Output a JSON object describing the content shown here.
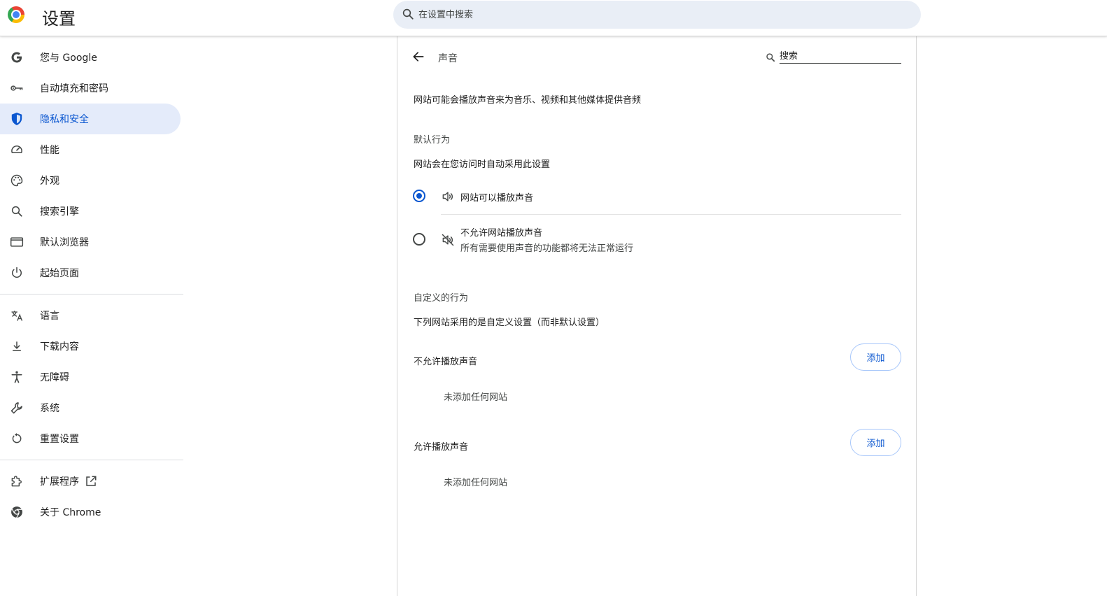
{
  "header": {
    "title": "设置",
    "search_placeholder": "在设置中搜索"
  },
  "sidebar": {
    "items": [
      {
        "label": "您与 Google",
        "icon": "google-g-icon"
      },
      {
        "label": "自动填充和密码",
        "icon": "key-icon"
      },
      {
        "label": "隐私和安全",
        "icon": "shield-icon",
        "active": true
      },
      {
        "label": "性能",
        "icon": "speedometer-icon"
      },
      {
        "label": "外观",
        "icon": "palette-icon"
      },
      {
        "label": "搜索引擎",
        "icon": "search-icon"
      },
      {
        "label": "默认浏览器",
        "icon": "browser-window-icon"
      },
      {
        "label": "起始页面",
        "icon": "power-icon"
      },
      {
        "label": "语言",
        "icon": "translate-icon"
      },
      {
        "label": "下载内容",
        "icon": "download-icon"
      },
      {
        "label": "无障碍",
        "icon": "accessibility-icon"
      },
      {
        "label": "系统",
        "icon": "wrench-icon"
      },
      {
        "label": "重置设置",
        "icon": "reset-icon"
      },
      {
        "label": "扩展程序",
        "icon": "puzzle-icon"
      },
      {
        "label": "关于 Chrome",
        "icon": "chrome-icon"
      }
    ]
  },
  "main": {
    "page_title": "声音",
    "search_placeholder": "搜索",
    "description": "网站可能会播放声音来为音乐、视频和其他媒体提供音频",
    "default_behavior": {
      "heading": "默认行为",
      "subheading": "网站会在您访问时自动采用此设置",
      "options": [
        {
          "label": "网站可以播放声音",
          "icon": "volume-up-icon",
          "checked": true
        },
        {
          "label": "不允许网站播放声音",
          "sublabel": "所有需要使用声音的功能都将无法正常运行",
          "icon": "volume-off-icon",
          "checked": false
        }
      ]
    },
    "custom_behavior": {
      "heading": "自定义的行为",
      "subheading": "下列网站采用的是自定义设置（而非默认设置）",
      "blocked": {
        "title": "不允许播放声音",
        "add_label": "添加",
        "empty": "未添加任何网站"
      },
      "allowed": {
        "title": "允许播放声音",
        "add_label": "添加",
        "empty": "未添加任何网站"
      }
    }
  },
  "colors": {
    "accent": "#0b57d0",
    "active_bg": "#e4ebfa",
    "search_bg": "#e9eef6"
  }
}
